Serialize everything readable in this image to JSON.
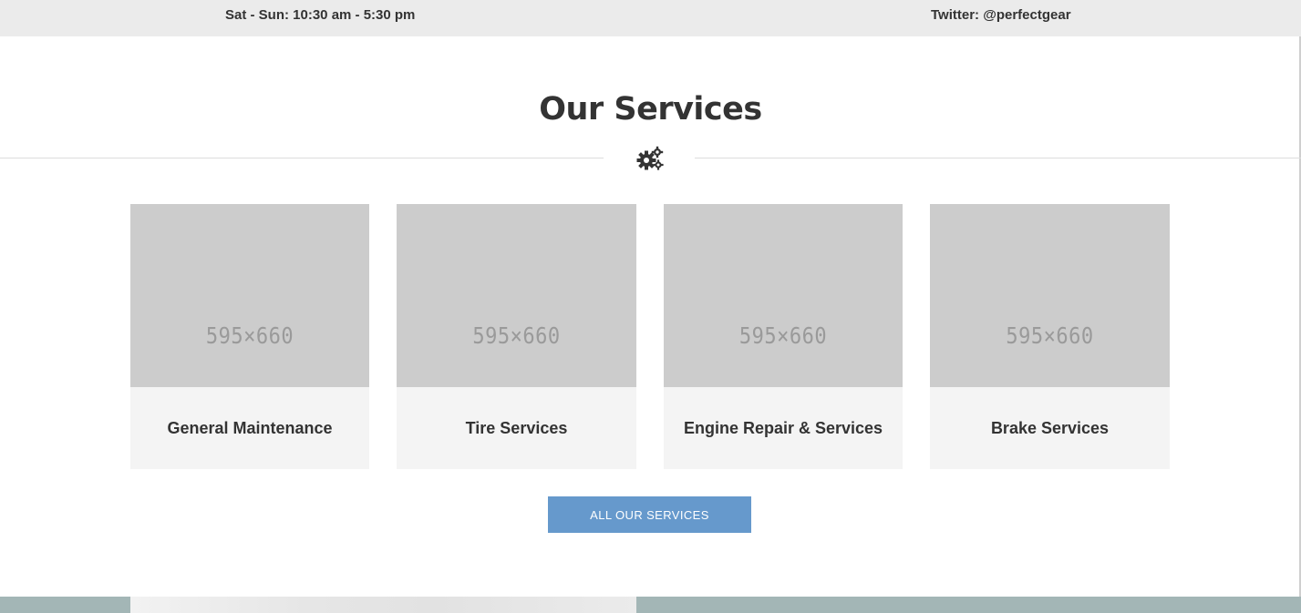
{
  "contact_bar": {
    "hours_weekend": "Sat - Sun: 10:30 am - 5:30 pm",
    "twitter": "Twitter: @perfectgear",
    "cut_left": "",
    "cut_mid": "",
    "cut_right": ""
  },
  "services": {
    "heading": "Our Services",
    "divider_icon": "gears-icon",
    "cards": [
      {
        "image_placeholder": "595×660",
        "title": "General Maintenance"
      },
      {
        "image_placeholder": "595×660",
        "title": "Tire Services"
      },
      {
        "image_placeholder": "595×660",
        "title": "Engine Repair & Services"
      },
      {
        "image_placeholder": "595×660",
        "title": "Brake Services"
      }
    ],
    "button_label": "ALL OUR SERVICES"
  },
  "colors": {
    "topbar_bg": "#ebebeb",
    "card_bg": "#f4f4f4",
    "image_placeholder_bg": "#cccccc",
    "button_bg": "#6699cc",
    "text": "#333333",
    "bottom_band": "#a3b6b6"
  }
}
